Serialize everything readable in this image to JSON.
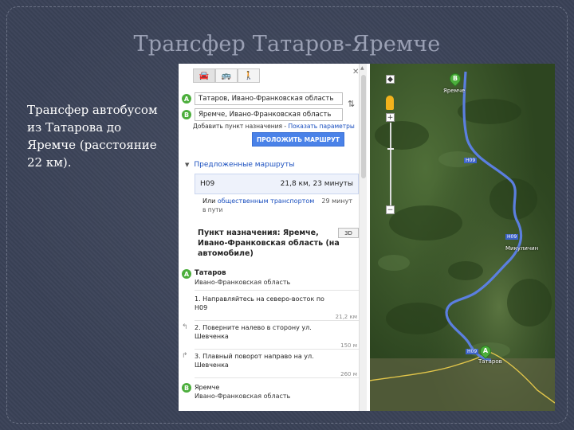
{
  "slide": {
    "title": "Трансфер Татаров-Яремче",
    "body": "Трансфер автобусом из Татарова до Яремче (расстояние 22 км)."
  },
  "maps_panel": {
    "modes": [
      {
        "icon": "car-icon",
        "glyph": "🚘"
      },
      {
        "icon": "bus-icon",
        "glyph": "🚌"
      },
      {
        "icon": "walk-icon",
        "glyph": "🚶"
      }
    ],
    "close_glyph": "✕",
    "origin": {
      "marker": "A",
      "value": "Татаров, Ивано-Франковская область"
    },
    "destination": {
      "marker": "B",
      "value": "Яремче, Ивано-Франковская область"
    },
    "swap_glyph": "⇅",
    "links_prefix": "Добавить пункт назначения",
    "links_sep": " - ",
    "link_options": "Показать параметры",
    "route_button": "ПРОЛОЖИТЬ МАРШРУТ",
    "suggested_title": "Предложенные маршруты",
    "suggested_route": {
      "road": "H09",
      "summary": "21,8 км, 23 минуты"
    },
    "transit": {
      "prefix": "Или",
      "link": "общественным транспортом",
      "suffix": "в пути",
      "time": "29 минут"
    },
    "destination_heading": "Пункт назначения: Яремче, Ивано-Франковская область (на автомобиле)",
    "button_3d": "3D",
    "start_place": {
      "marker": "A",
      "name": "Татаров",
      "region": "Ивано-Франковская область"
    },
    "steps": [
      {
        "text": "1. Направляйтесь на северо-восток по H09",
        "distance": "21,2 км",
        "icon": "straight-icon",
        "glyph": ""
      },
      {
        "text": "2. Поверните налево в сторону ул. Шевченка",
        "distance": "150 м",
        "icon": "turn-left-icon",
        "glyph": "↰"
      },
      {
        "text": "3. Плавный поворот направо на ул. Шевченка",
        "distance": "260 м",
        "icon": "slight-right-icon",
        "glyph": "↱"
      }
    ],
    "end_place": {
      "marker": "B",
      "name": "Яремче",
      "region": "Ивано-Франковская область"
    }
  },
  "map": {
    "pin_b": "B",
    "pin_a": "A",
    "label_b": "Яремче",
    "label_mid": "Микуличин",
    "label_a": "Татаров",
    "shields": [
      "H09",
      "H09",
      "H09"
    ],
    "zoom_plus": "+",
    "zoom_minus": "−",
    "colors": {
      "route": "#5b7fe0",
      "forest": "#3d5a2a",
      "road_yellow": "#e2c64a"
    }
  }
}
